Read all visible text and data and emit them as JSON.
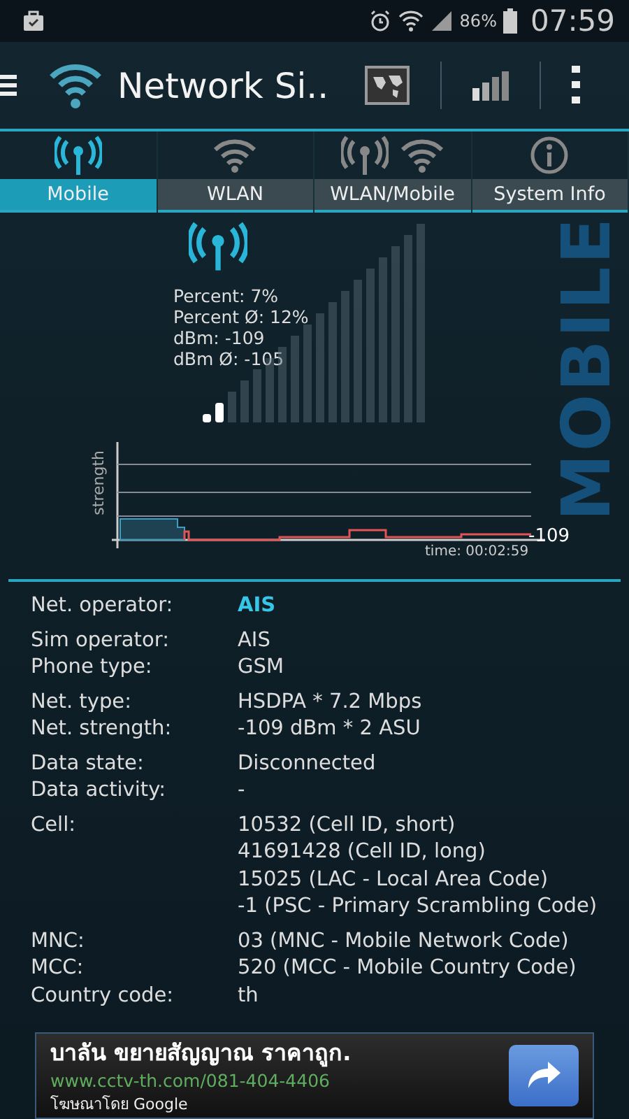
{
  "status_bar": {
    "battery": "86%",
    "time": "07:59"
  },
  "app_bar": {
    "title": "Network Si.."
  },
  "tabs": [
    {
      "label": "Mobile",
      "kind": "mobile",
      "selected": true
    },
    {
      "label": "WLAN",
      "kind": "wlan",
      "selected": false
    },
    {
      "label": "WLAN/Mobile",
      "kind": "both",
      "selected": false
    },
    {
      "label": "System Info",
      "kind": "info",
      "selected": false
    }
  ],
  "signal": {
    "stats": [
      "Percent: 7%",
      "Percent Ø: 12%",
      "dBm: -109",
      "dBm Ø: -105"
    ],
    "side_label": "MOBILE"
  },
  "graph": {
    "axis_label": "strength",
    "reading": "-109",
    "time": "time: 00:02:59"
  },
  "details": [
    [
      {
        "label": "Net. operator:",
        "lines": [
          "AIS"
        ],
        "emphasis": true
      }
    ],
    [
      {
        "label": "Sim operator:",
        "lines": [
          "AIS"
        ],
        "emphasis": false
      },
      {
        "label": "Phone type:",
        "lines": [
          "GSM"
        ],
        "emphasis": false
      }
    ],
    [
      {
        "label": "Net. type:",
        "lines": [
          "HSDPA * 7.2 Mbps"
        ],
        "emphasis": false
      },
      {
        "label": "Net. strength:",
        "lines": [
          "-109 dBm * 2 ASU"
        ],
        "emphasis": false
      }
    ],
    [
      {
        "label": "Data state:",
        "lines": [
          "Disconnected"
        ],
        "emphasis": false
      },
      {
        "label": "Data activity:",
        "lines": [
          "-"
        ],
        "emphasis": false
      }
    ],
    [
      {
        "label": "Cell:",
        "lines": [
          "10532 (Cell ID, short)",
          "41691428 (Cell ID, long)",
          "15025 (LAC - Local Area Code)",
          "-1 (PSC - Primary Scrambling Code)"
        ],
        "emphasis": false
      }
    ],
    [
      {
        "label": "MNC:",
        "lines": [
          "03 (MNC - Mobile Network Code)"
        ],
        "emphasis": false
      },
      {
        "label": "MCC:",
        "lines": [
          "520 (MCC - Mobile Country Code)"
        ],
        "emphasis": false
      },
      {
        "label": "Country code:",
        "lines": [
          "th"
        ],
        "emphasis": false
      }
    ]
  ],
  "ad": {
    "headline": "บาลัน ขยายสัญญาณ ราคาถูก.",
    "url": "www.cctv-th.com/081-404-4406",
    "attribution": "โฆษณาโดย Google"
  }
}
